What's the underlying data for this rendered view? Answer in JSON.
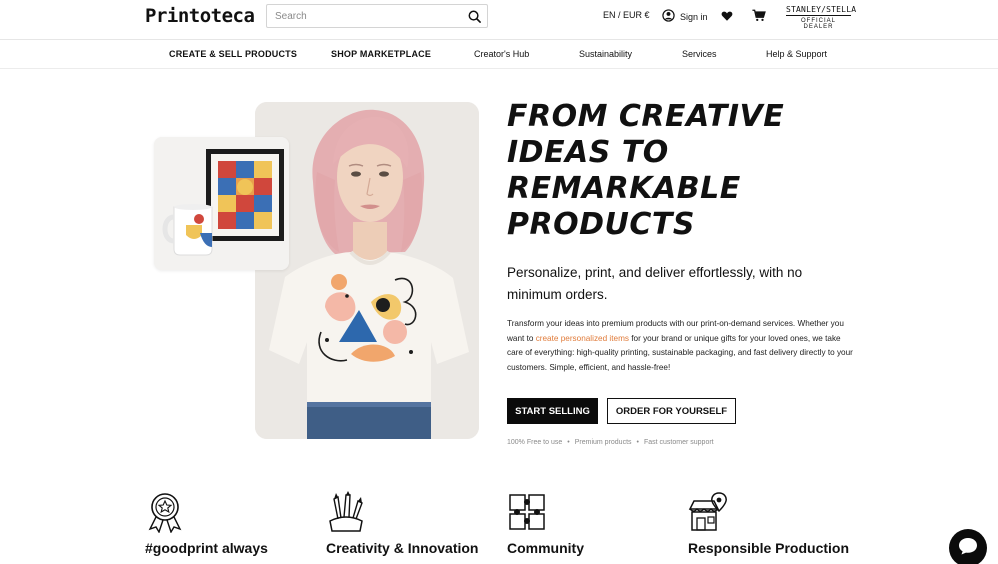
{
  "header": {
    "logo_text": "Printoteca",
    "search_placeholder": "Search",
    "language_currency": "EN / EUR €",
    "sign_in_label": "Sign in",
    "dealer_brand": "STANLEY/STELLA",
    "dealer_label": "OFFICIAL DEALER"
  },
  "nav": {
    "items": [
      "CREATE & SELL PRODUCTS",
      "SHOP MARKETPLACE",
      "Creator's Hub",
      "Sustainability",
      "Services",
      "Help & Support"
    ]
  },
  "hero": {
    "headline": "FROM CREATIVE IDEAS TO REMARKABLE PRODUCTS",
    "subheadline": "Personalize, print, and deliver effortlessly, with no minimum orders.",
    "body_before_link": "Transform your ideas into premium products with our print-on-demand services. Whether you want to ",
    "body_link": "create personalized items",
    "body_after_link": " for your brand or unique gifts for your loved ones, we take care of everything: high-quality printing, sustainable packaging, and fast delivery directly to your customers. Simple, efficient, and hassle-free!",
    "primary_button": "START SELLING",
    "secondary_button": "ORDER FOR YOURSELF",
    "perks": [
      "100% Free to use",
      "Premium products",
      "Fast customer support"
    ]
  },
  "features": [
    {
      "title": "#goodprint always",
      "icon": "award-icon"
    },
    {
      "title": "Creativity & Innovation",
      "icon": "brushes-icon"
    },
    {
      "title": "Community",
      "icon": "puzzle-hands-icon"
    },
    {
      "title": "Responsible Production",
      "icon": "shop-location-icon"
    }
  ],
  "colors": {
    "accent_link": "#e07b3a",
    "button_dark": "#0b0b0b"
  }
}
